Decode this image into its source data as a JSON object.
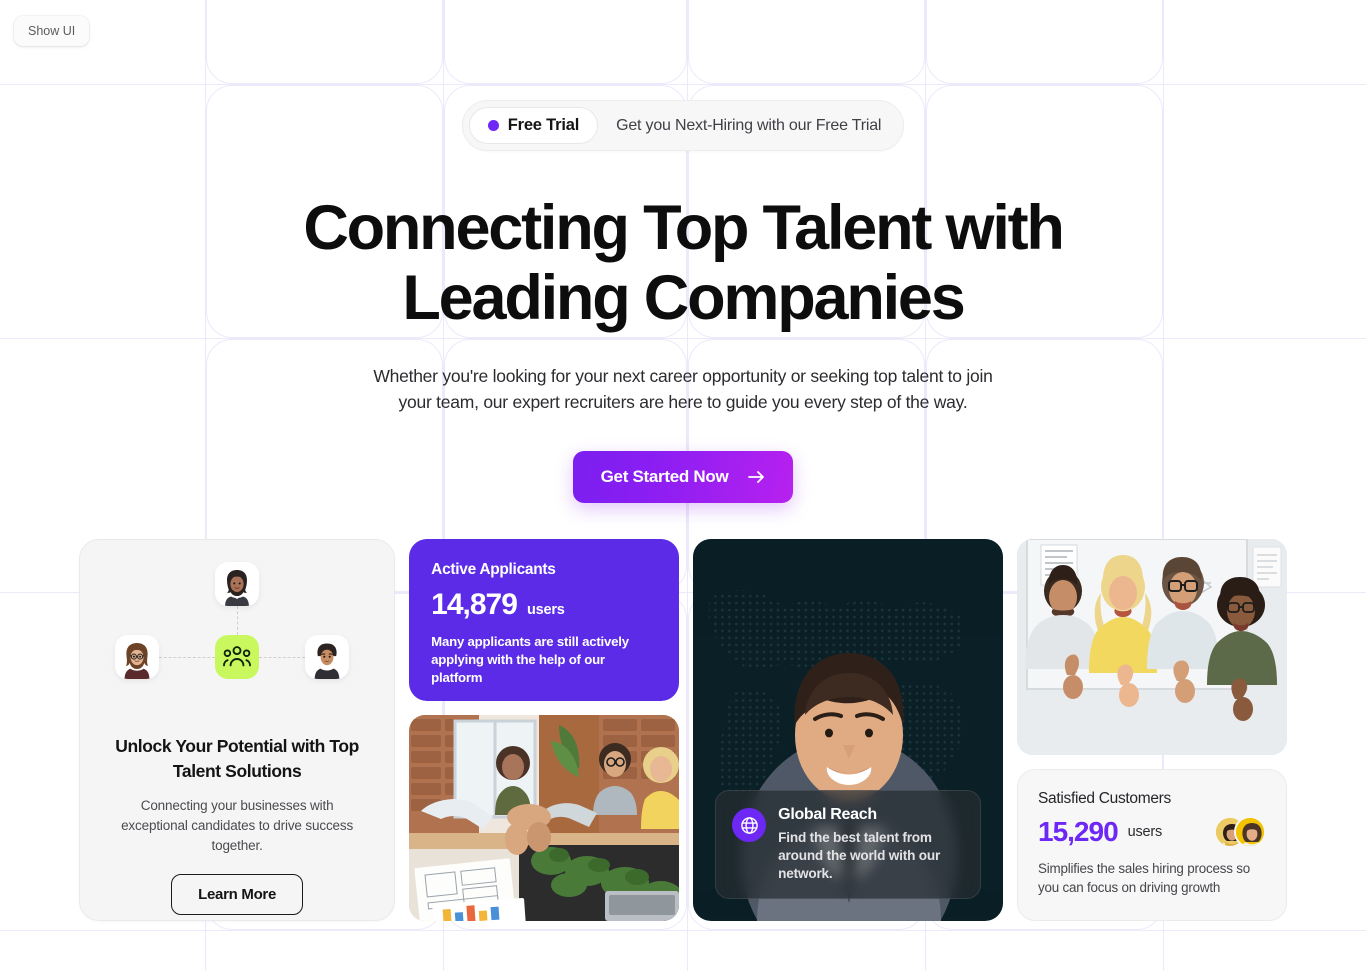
{
  "show_ui": {
    "label": "Show UI"
  },
  "hero": {
    "badge": {
      "pill_label": "Free Trial",
      "note": "Get you Next-Hiring with our Free Trial",
      "dot_color": "#6d28f5"
    },
    "title_line1": "Connecting Top Talent with",
    "title_line2": "Leading Companies",
    "subtitle_line1": "Whether you're looking for your next career opportunity or seeking top talent to join",
    "subtitle_line2": "your team, our expert recruiters are here to guide you every step of the way.",
    "cta_label": "Get Started Now"
  },
  "talent_card": {
    "title": "Unlock Your Potential with Top Talent Solutions",
    "description": "Connecting your businesses with exceptional candidates to drive success together.",
    "button_label": "Learn More",
    "nodes": [
      {
        "name": "avatar-top"
      },
      {
        "name": "avatar-left"
      },
      {
        "name": "avatar-center-group"
      },
      {
        "name": "avatar-right"
      }
    ]
  },
  "active_applicants": {
    "label": "Active Applicants",
    "value": "14,879",
    "unit": "users",
    "description": "Many applicants are still actively applying with the help of our platform",
    "bg_color": "#5b2be8"
  },
  "global_reach": {
    "title": "Global Reach",
    "description": "Find the best talent from around the world with our network.",
    "icon": "globe-icon",
    "bg_color": "#0b2026",
    "accent_color": "#6d28f5"
  },
  "satisfied_customers": {
    "label": "Satisfied Customers",
    "value": "15,290",
    "unit": "users",
    "description": "Simplifies the sales hiring process so you can focus on driving growth",
    "value_color": "#6d28f5"
  },
  "theme": {
    "grid_line_color": "#ece9fb",
    "cta_gradient_from": "#7b1ff0",
    "cta_gradient_to": "#b721ef",
    "green_accent": "#c9f85e"
  }
}
